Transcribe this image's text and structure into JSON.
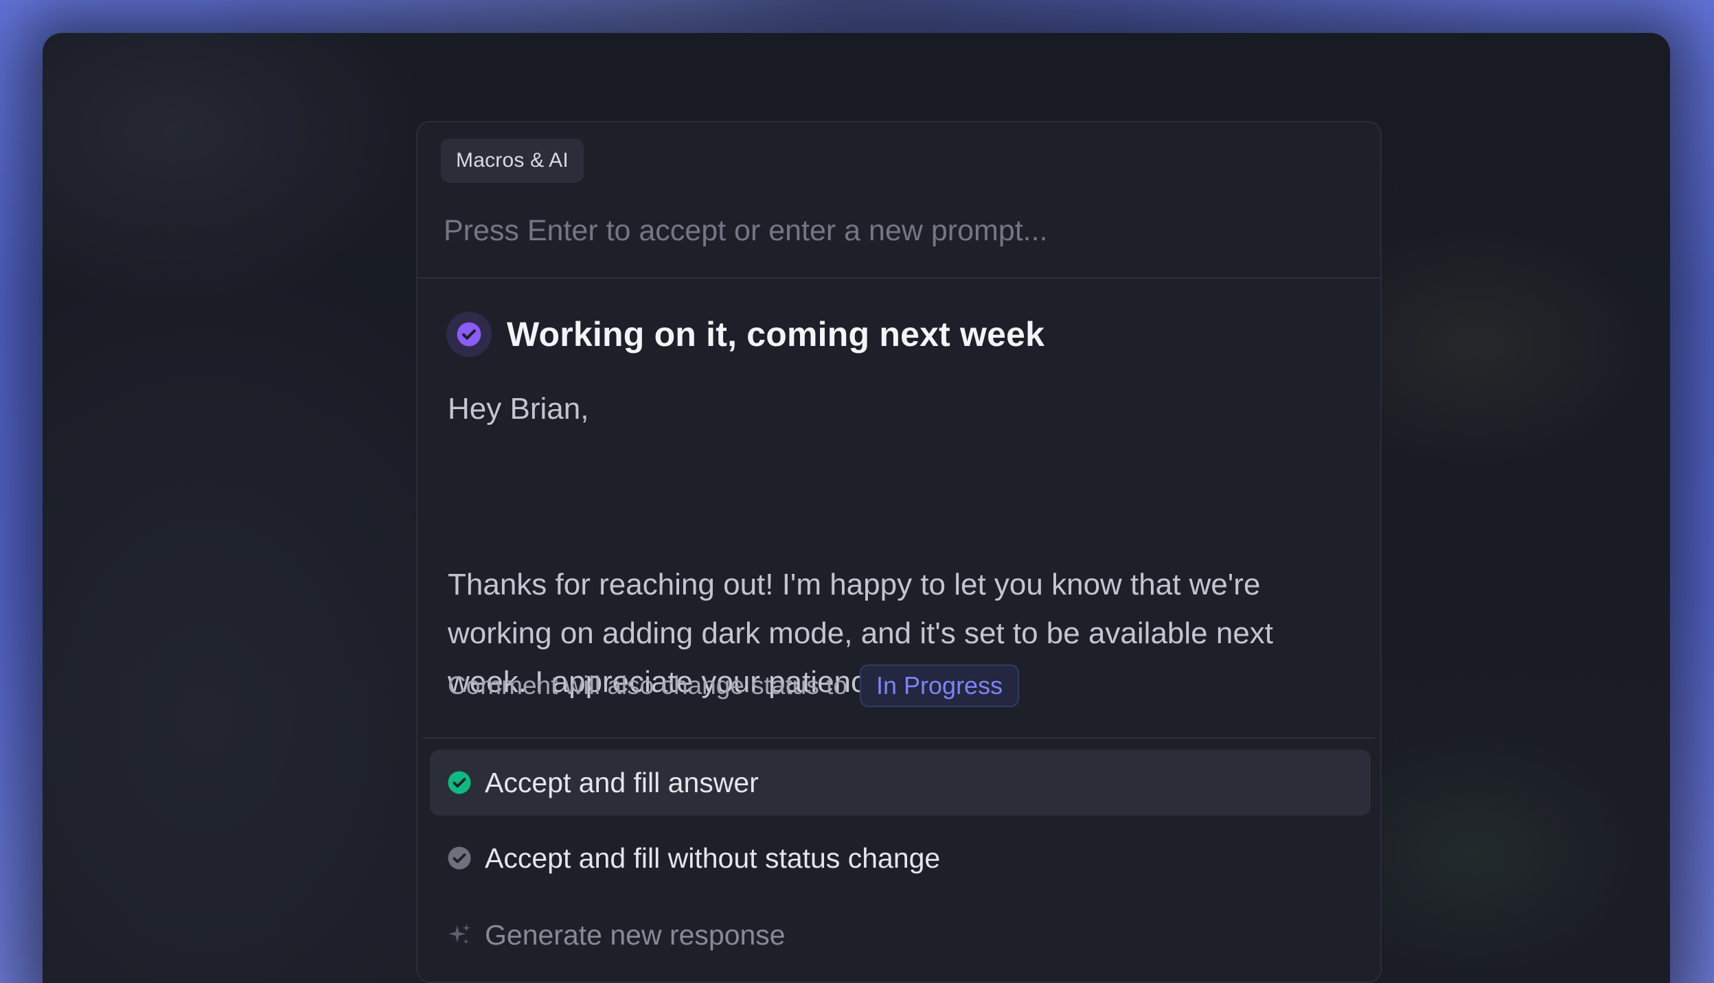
{
  "panel": {
    "tag": "Macros & AI",
    "prompt_placeholder": "Press Enter to accept or enter a new prompt..."
  },
  "suggestion": {
    "title": "Working on it, coming next week",
    "title_icon": "check-circle-icon",
    "greeting": "Hey Brian,",
    "message": "Thanks for reaching out! I'm happy to let you know that we're working on adding dark mode, and it's set to be available next week. I appreciate your patience!",
    "status_label": "Comment will also change status to",
    "status_value": "In Progress"
  },
  "options": [
    {
      "label": "Accept and fill answer",
      "icon": "check-circle-icon",
      "active": true
    },
    {
      "label": "Accept and fill without status change",
      "icon": "check-circle-icon",
      "active": false
    },
    {
      "label": "Generate new response",
      "icon": "sparkle-icon",
      "active": false
    }
  ],
  "colors": {
    "accent_purple": "#8b5cf6",
    "accept_green": "#10b981",
    "status_blue": "#7f83f7",
    "panel_bg": "#1e2029"
  }
}
